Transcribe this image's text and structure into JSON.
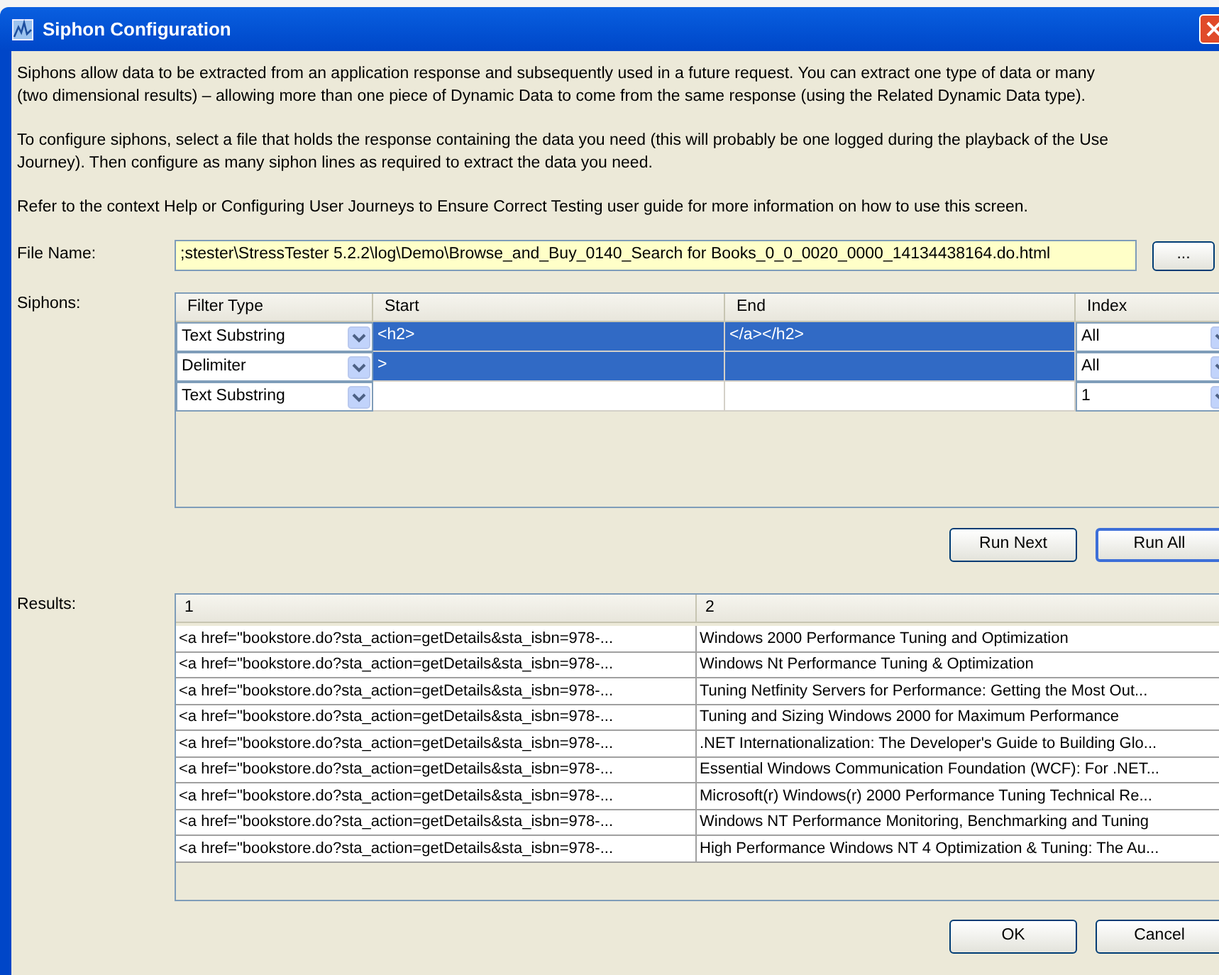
{
  "window": {
    "title": "Siphon Configuration"
  },
  "intro": [
    "Siphons allow data to be extracted from an application response and subsequently used in a future request.  You can extract one type of data or many",
    "(two dimensional results) – allowing more than one piece of Dynamic Data to come from the same response (using the Related Dynamic Data type).",
    "To configure siphons, select a file that holds the response containing the data you need (this will probably be one logged during the playback of the Use",
    "Journey).  Then configure as many siphon lines as required to extract the data you need.",
    "Refer to the context Help or Configuring User Journeys to Ensure Correct Testing user guide for more information on how to use this screen."
  ],
  "file_name": {
    "label": "File Name:",
    "value": ";stester\\StressTester 5.2.2\\log\\Demo\\Browse_and_Buy_0140_Search for Books_0_0_0020_0000_14134438164.do.html",
    "browse_button": "..."
  },
  "siphons": {
    "label": "Siphons:",
    "columns": [
      "Filter Type",
      "Start",
      "End",
      "Index"
    ],
    "rows": [
      {
        "filter_type": "Text Substring",
        "start": "<h2>",
        "end": "</a></h2>",
        "index": "All",
        "selected": true
      },
      {
        "filter_type": "Delimiter",
        "start": ">",
        "end": "",
        "index": "All",
        "selected": true
      },
      {
        "filter_type": "Text Substring",
        "start": "",
        "end": "",
        "index": "1",
        "selected": false
      }
    ]
  },
  "run_buttons": [
    {
      "label": "Run Next",
      "default": false
    },
    {
      "label": "Run All",
      "default": true
    }
  ],
  "results": {
    "label": "Results:",
    "columns": [
      "1",
      "2"
    ],
    "rows": [
      [
        "<a href=\"bookstore.do?sta_action=getDetails&sta_isbn=978-...",
        "Windows 2000 Performance Tuning and Optimization"
      ],
      [
        "<a href=\"bookstore.do?sta_action=getDetails&sta_isbn=978-...",
        "Windows Nt Performance Tuning & Optimization"
      ],
      [
        "<a href=\"bookstore.do?sta_action=getDetails&sta_isbn=978-...",
        "Tuning Netfinity Servers for Performance: Getting the Most Out..."
      ],
      [
        "<a href=\"bookstore.do?sta_action=getDetails&sta_isbn=978-...",
        "Tuning and Sizing Windows 2000 for Maximum Performance"
      ],
      [
        "<a href=\"bookstore.do?sta_action=getDetails&sta_isbn=978-...",
        ".NET Internationalization: The Developer's Guide to Building Glo..."
      ],
      [
        "<a href=\"bookstore.do?sta_action=getDetails&sta_isbn=978-...",
        "Essential Windows Communication Foundation (WCF): For .NET..."
      ],
      [
        "<a href=\"bookstore.do?sta_action=getDetails&sta_isbn=978-...",
        "Microsoft(r) Windows(r) 2000 Performance Tuning Technical Re..."
      ],
      [
        "<a href=\"bookstore.do?sta_action=getDetails&sta_isbn=978-...",
        "Windows NT Performance Monitoring, Benchmarking and Tuning"
      ],
      [
        "<a href=\"bookstore.do?sta_action=getDetails&sta_isbn=978-...",
        "High Performance Windows NT 4 Optimization & Tuning: The Au..."
      ]
    ]
  },
  "dialog_buttons": [
    "OK",
    "Cancel"
  ]
}
